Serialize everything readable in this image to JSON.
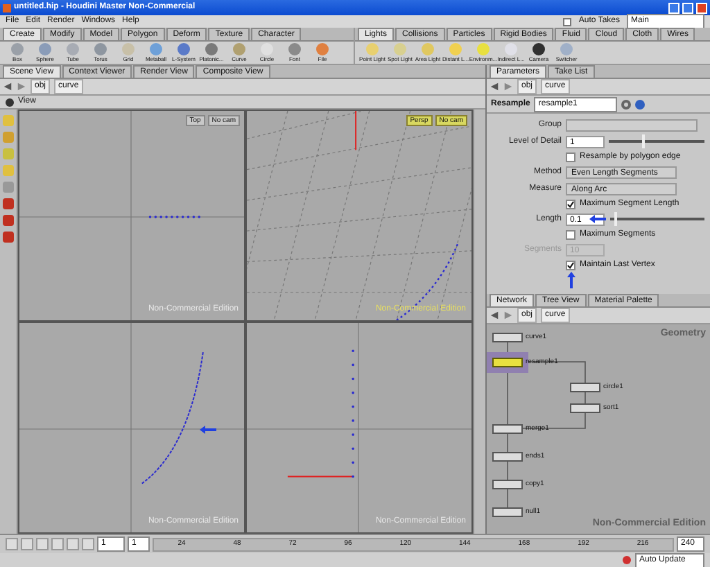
{
  "window": {
    "title": "untitled.hip - Houdini Master Non-Commercial"
  },
  "menu": [
    "File",
    "Edit",
    "Render",
    "Windows",
    "Help"
  ],
  "shelf_tabs_left": [
    {
      "label": "Create",
      "selected": true
    },
    {
      "label": "Modify",
      "selected": false
    },
    {
      "label": "Model",
      "selected": false
    },
    {
      "label": "Polygon",
      "selected": false
    },
    {
      "label": "Deform",
      "selected": false
    },
    {
      "label": "Texture",
      "selected": false
    },
    {
      "label": "Character",
      "selected": false
    }
  ],
  "shelf_tools_left": [
    "Box",
    "Sphere",
    "Tube",
    "Torus",
    "Grid",
    "Metaball",
    "L-System",
    "Platonic...",
    "Curve",
    "Circle",
    "Font",
    "File"
  ],
  "take": {
    "auto_takes": {
      "label": "Auto Takes",
      "checked": false
    },
    "value": "Main"
  },
  "shelf_tabs_right": [
    {
      "label": "Lights",
      "selected": true
    },
    {
      "label": "Collisions",
      "selected": false
    },
    {
      "label": "Particles",
      "selected": false
    },
    {
      "label": "Rigid Bodies",
      "selected": false
    },
    {
      "label": "Fluid",
      "selected": false
    },
    {
      "label": "Cloud",
      "selected": false
    },
    {
      "label": "Cloth",
      "selected": false
    },
    {
      "label": "Wires",
      "selected": false
    }
  ],
  "shelf_tools_right": [
    "Point Light",
    "Spot Light",
    "Area Light",
    "Distant L...",
    "Environm...",
    "Indirect L...",
    "Camera",
    "Switcher"
  ],
  "pane_tabs_left": [
    {
      "label": "Scene View",
      "selected": true
    },
    {
      "label": "Context Viewer",
      "selected": false
    },
    {
      "label": "Render View",
      "selected": false
    },
    {
      "label": "Composite View",
      "selected": false
    }
  ],
  "path_left": [
    "obj",
    "curve"
  ],
  "viewer": {
    "title": "View",
    "viewports": [
      {
        "kind": "top",
        "buttons": [
          "Top",
          "No cam"
        ],
        "watermark": "Non-Commercial Edition"
      },
      {
        "kind": "persp",
        "buttons": [
          "Persp",
          "No cam"
        ],
        "watermark": "Non-Commercial Edition"
      },
      {
        "kind": "front",
        "watermark": "Non-Commercial Edition"
      },
      {
        "kind": "side",
        "watermark": "Non-Commercial Edition"
      }
    ]
  },
  "pane_tabs_right": [
    {
      "label": "Parameters",
      "selected": true
    },
    {
      "label": "Take List",
      "selected": false
    }
  ],
  "path_right": [
    "obj",
    "curve"
  ],
  "params": {
    "node_type": "Resample",
    "node_name": "resample1",
    "rows": [
      {
        "kind": "menu",
        "label": "Group",
        "value": ""
      },
      {
        "kind": "slider",
        "label": "Level of Detail",
        "value": "1",
        "level": 0.35
      },
      {
        "kind": "check",
        "label": "Resample by polygon edge",
        "checked": false
      },
      {
        "kind": "menu",
        "label": "Method",
        "value": "Even Length Segments"
      },
      {
        "kind": "menu",
        "label": "Measure",
        "value": "Along Arc"
      },
      {
        "kind": "check",
        "label": "Maximum Segment Length",
        "checked": true
      },
      {
        "kind": "slider",
        "label": "Length",
        "value": "0.1",
        "level": 0.05
      },
      {
        "kind": "check",
        "label": "Maximum Segments",
        "checked": false
      },
      {
        "kind": "field",
        "label": "Segments",
        "value": "10",
        "disabled": true
      },
      {
        "kind": "check",
        "label": "Maintain Last Vertex",
        "checked": true
      }
    ]
  },
  "network": {
    "tabs": [
      {
        "label": "Network",
        "selected": true
      },
      {
        "label": "Tree View",
        "selected": false
      },
      {
        "label": "Material Palette",
        "selected": false
      }
    ],
    "path": [
      "obj",
      "curve"
    ],
    "context": "Geometry",
    "watermark": "Non-Commercial Edition",
    "nodes": [
      {
        "name": "curve1",
        "selected": false
      },
      {
        "name": "resample1",
        "selected": true
      },
      {
        "name": "circle1",
        "selected": false
      },
      {
        "name": "sort1",
        "selected": false
      },
      {
        "name": "merge1",
        "selected": false
      },
      {
        "name": "ends1",
        "selected": false
      },
      {
        "name": "copy1",
        "selected": false
      },
      {
        "name": "null1",
        "selected": false
      }
    ]
  },
  "timeline": {
    "frame": "1",
    "step": "1",
    "ticks": [
      "24",
      "48",
      "72",
      "96",
      "120",
      "144",
      "168",
      "192",
      "216"
    ],
    "end": "240"
  },
  "status": "Auto Update"
}
